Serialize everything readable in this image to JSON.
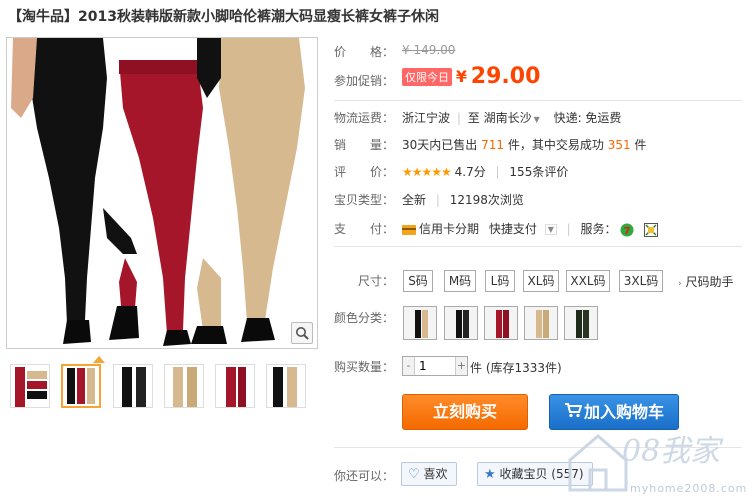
{
  "product": {
    "title": "【淘牛品】2013秋装韩版新款小脚哈伦裤潮大码显瘦长裤女裤子休闲"
  },
  "price": {
    "label": "价　　格：",
    "original": "¥ 149.00",
    "promo_label": "参加促销：",
    "promo_badge": "仅限今日",
    "currency": "¥",
    "current": "29.00"
  },
  "shipping": {
    "label": "物流运费：",
    "from": "浙江宁波",
    "to_prefix": "至",
    "to": "湖南长沙",
    "method": "快递: 免运费"
  },
  "sales": {
    "label": "销　　量：",
    "prefix": "30天内已售出",
    "sold": "711",
    "mid": "件，其中交易成功",
    "success": "351",
    "suffix": "件"
  },
  "rating": {
    "label": "评　　价：",
    "stars": "★★★★★",
    "score": "4.7分",
    "reviews": "155条评价"
  },
  "type": {
    "label": "宝贝类型：",
    "condition": "全新",
    "views": "12198次浏览"
  },
  "payment": {
    "label": "支　　付：",
    "credit": "信用卡分期",
    "quick": "快捷支付",
    "service_label": "服务："
  },
  "size": {
    "label": "尺寸：",
    "options": [
      "S码",
      "M码",
      "L码",
      "XL码",
      "XXL码",
      "3XL码"
    ],
    "helper": "尺码助手"
  },
  "colors": {
    "label": "颜色分类："
  },
  "quantity": {
    "label": "购买数量：",
    "value": "1",
    "minus": "-",
    "plus": "+",
    "stock": "件 (库存1333件)"
  },
  "actions": {
    "buy_now": "立刻购买",
    "add_to_cart": "加入购物车"
  },
  "share": {
    "label": "你还可以：",
    "like": "喜欢",
    "favorite": "收藏宝贝 (557)"
  },
  "watermark": {
    "text": "08我家",
    "url": "myhome2008.com"
  },
  "colors_theme": {
    "accent_orange": "#f40",
    "buy_orange": "#f56a00",
    "cart_blue": "#1a6fc9",
    "black": "#111111",
    "wine": "#a5162a",
    "khaki": "#d6b98e"
  }
}
